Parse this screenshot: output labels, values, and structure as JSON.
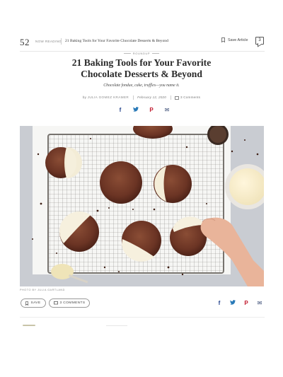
{
  "topbar": {
    "logo": "52",
    "now_reading_label": "NOW READING",
    "now_reading_title": "21 Baking Tools for Your Favorite Chocolate Desserts & Beyond",
    "save_label": "Save Article",
    "comment_count": "3"
  },
  "article": {
    "kicker": "ROUNDUP",
    "title_line1": "21 Baking Tools for Your Favorite",
    "title_line2": "Chocolate Desserts & Beyond",
    "dek": "Chocolate fondue, cake, truffles—you name it.",
    "byline_prefix": "by",
    "author": "JULIA GOMEZ KRAMER",
    "date": "February 12, 2020",
    "comments": "3 Comments",
    "photo_credit": "PHOTO BY JULIA GARTLAND"
  },
  "actions": {
    "save_label": "SAVE",
    "comments_label": "3 COMMENTS"
  },
  "share": {
    "facebook": "f",
    "twitter": "🐦",
    "pinterest": "P",
    "email": "✉"
  },
  "colors": {
    "facebook": "#1e3f8a",
    "twitter": "#2a7ab8",
    "pinterest": "#c0172b",
    "email": "#2a3d6a"
  }
}
